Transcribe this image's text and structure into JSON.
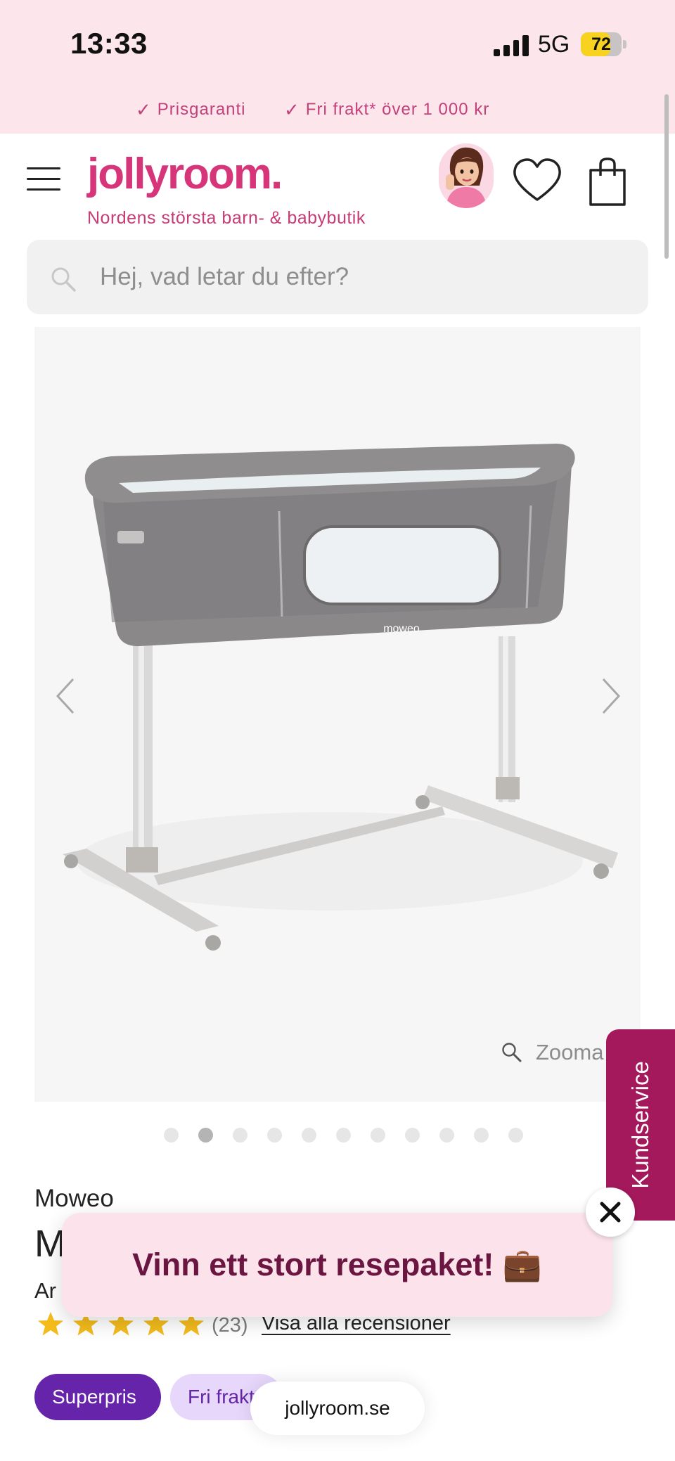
{
  "status_bar": {
    "time": "13:33",
    "network": "5G",
    "battery": "72",
    "battery_level": 0.72
  },
  "usp": [
    {
      "label": "Prisgaranti"
    },
    {
      "label": "Fri frakt* över 1 000 kr"
    }
  ],
  "header": {
    "logo": "jollyroom.",
    "tagline": "Nordens största barn- & babybutik",
    "icons": {
      "menu": "hamburger-menu-icon",
      "avatar": "avatar",
      "favorites": "heart-icon",
      "cart": "shopping-bag-icon"
    }
  },
  "search": {
    "placeholder": "Hej, vad letar du efter?"
  },
  "gallery": {
    "zoom_label": "Zooma",
    "image_logo": "moweo",
    "image_count": 11,
    "active_index": 1
  },
  "side_tab": {
    "label": "Kundservice"
  },
  "product": {
    "brand": "Moweo",
    "title_visible": "M",
    "subtitle_visible": "Ar",
    "rating": 5,
    "review_count": "(23)",
    "review_link": "Visa alla recensioner",
    "badges": [
      "Superpris",
      "Fri frakt"
    ]
  },
  "promo": {
    "text": "Vinn ett stort resepaket! 💼"
  },
  "browser": {
    "url": "jollyroom.se"
  },
  "colors": {
    "brand_pink": "#d7357a",
    "header_bg": "#fce6ec",
    "kundservice_bg": "#a4195c",
    "superpris_bg": "#6524a9",
    "star_yellow": "#f3bb1c"
  }
}
